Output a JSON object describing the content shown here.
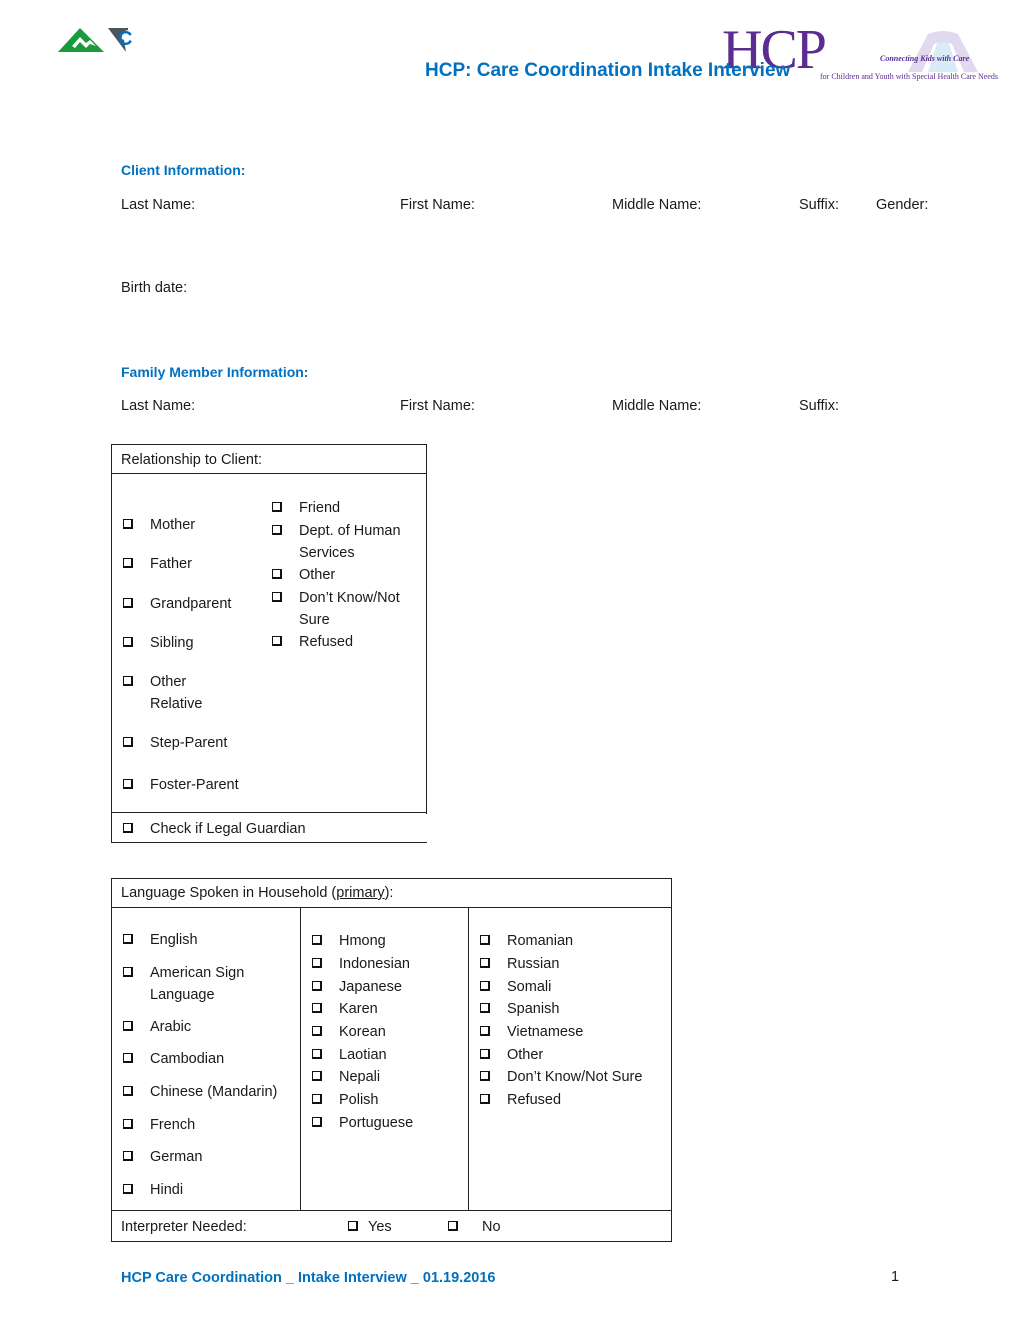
{
  "header": {
    "title": "HCP: Care Coordination Intake Interview",
    "logo_left_letter": "C",
    "hcp_logo": {
      "letters": "HCP",
      "tagline": "Connecting Kids with Care",
      "subtitle": "for Children and Youth with Special Health Care Needs"
    }
  },
  "client_info": {
    "heading": "Client Information:",
    "fields": [
      "Last Name:",
      "First Name:",
      "Middle Name:",
      "Suffix:",
      "Gender:"
    ],
    "birth_date_label": "Birth date:"
  },
  "family_info": {
    "heading": "Family Member Information:",
    "fields": [
      "Last Name:",
      "First Name:",
      "Middle Name:",
      "Suffix:"
    ]
  },
  "relationship": {
    "header": "Relationship to Client:",
    "left_options": [
      "Mother",
      "Father",
      "Grandparent",
      "Sibling",
      "Other Relative",
      "Step-Parent",
      "Foster-Parent"
    ],
    "right_options": [
      "Friend",
      "Dept. of Human Services",
      "Other",
      "Don’t Know/Not Sure",
      "Refused"
    ],
    "legal_guardian": "Check if Legal Guardian"
  },
  "language": {
    "header_prefix": "Language Spoken in Household (",
    "header_emphasis": "primary",
    "header_suffix": "):",
    "col1": [
      "English",
      "American Sign Language",
      "Arabic",
      "Cambodian",
      "Chinese (Mandarin)",
      "French",
      "German",
      "Hindi"
    ],
    "col2": [
      "Hmong",
      "Indonesian",
      "Japanese",
      "Karen",
      "Korean",
      "Laotian",
      "Nepali",
      "Polish",
      "Portuguese"
    ],
    "col3": [
      "Romanian",
      "Russian",
      "Somali",
      "Spanish",
      "Vietnamese",
      "Other",
      "Don’t Know/Not Sure",
      "Refused"
    ],
    "interpreter_label": "Interpreter Needed:",
    "interpreter_yes": "Yes",
    "interpreter_no": "No"
  },
  "footer": {
    "text": "HCP Care Coordination _ Intake Interview _ 01.19.2016",
    "page_number": "1"
  },
  "colors": {
    "accent_blue": "#0070c0",
    "hcp_purple": "#5b2d90",
    "logo_green": "#1a9a3c",
    "logo_gray": "#4d5559"
  }
}
